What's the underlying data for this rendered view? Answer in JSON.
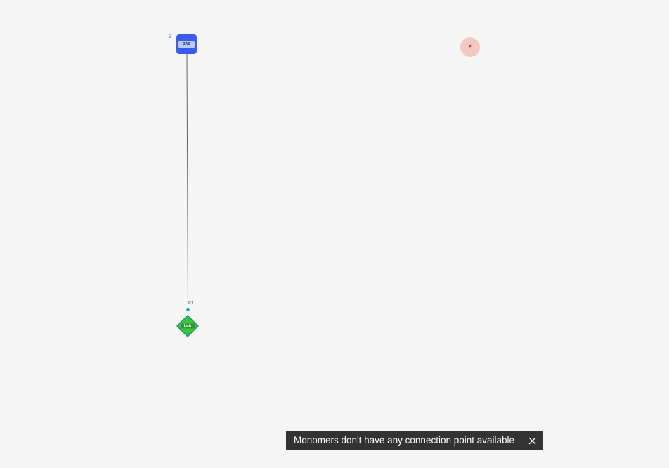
{
  "canvas": {
    "background": "#f5f5f5",
    "bond_color": "#666666"
  },
  "monomers": {
    "sugar": {
      "label": "3A6",
      "end_marker": "5'",
      "color": "#3b5bef"
    },
    "phosphate": {
      "label": "P",
      "color": "#f2c9c0"
    },
    "base": {
      "label": "baA",
      "attachment_point": "R1",
      "attachment_color": "#0aa0a8",
      "color": "#3ec43e"
    }
  },
  "toast": {
    "message": "Monomers don't have any connection point available",
    "close_icon": "close-icon"
  }
}
